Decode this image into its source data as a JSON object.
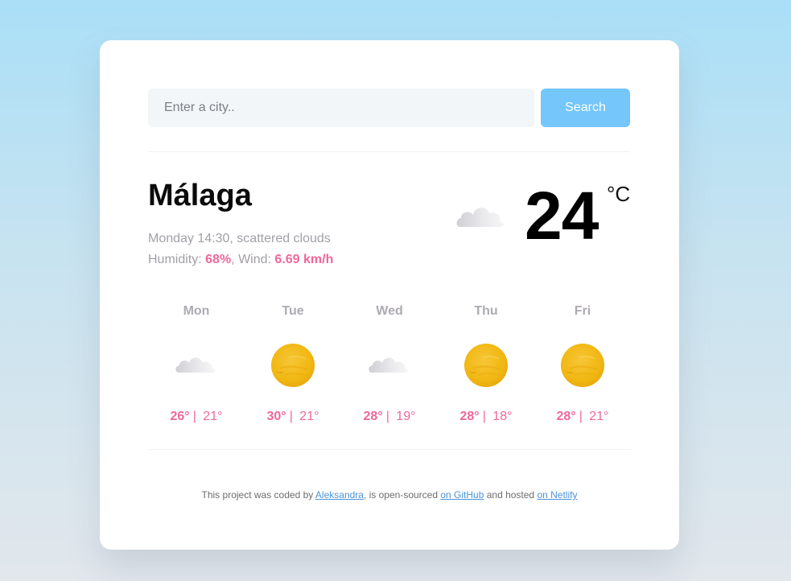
{
  "search": {
    "placeholder": "Enter a city..",
    "button_label": "Search"
  },
  "current": {
    "city": "Málaga",
    "datetime": "Monday 14:30",
    "description": "scattered clouds",
    "humidity_label": "Humidity:",
    "humidity": "68%",
    "wind_label": "Wind:",
    "wind": "6.69 km/h",
    "icon": "scattered-clouds-icon",
    "temperature": "24",
    "unit": "°C"
  },
  "forecast": [
    {
      "day": "Mon",
      "icon": "cloud-icon",
      "max": "26°",
      "min": "21°"
    },
    {
      "day": "Tue",
      "icon": "sun-icon",
      "max": "30°",
      "min": "21°"
    },
    {
      "day": "Wed",
      "icon": "cloud-icon",
      "max": "28°",
      "min": "19°"
    },
    {
      "day": "Thu",
      "icon": "sun-icon",
      "max": "28°",
      "min": "18°"
    },
    {
      "day": "Fri",
      "icon": "sun-icon",
      "max": "28°",
      "min": "21°"
    }
  ],
  "footer": {
    "text1": "This project was coded by ",
    "author": "Aleksandra",
    "text2": ", is open-sourced ",
    "github": "on GitHub",
    "text3": " and hosted ",
    "netlify": "on Netlify"
  },
  "colors": {
    "accent": "#f0679a",
    "button": "#74c6fb",
    "sun": "#f4b914"
  }
}
